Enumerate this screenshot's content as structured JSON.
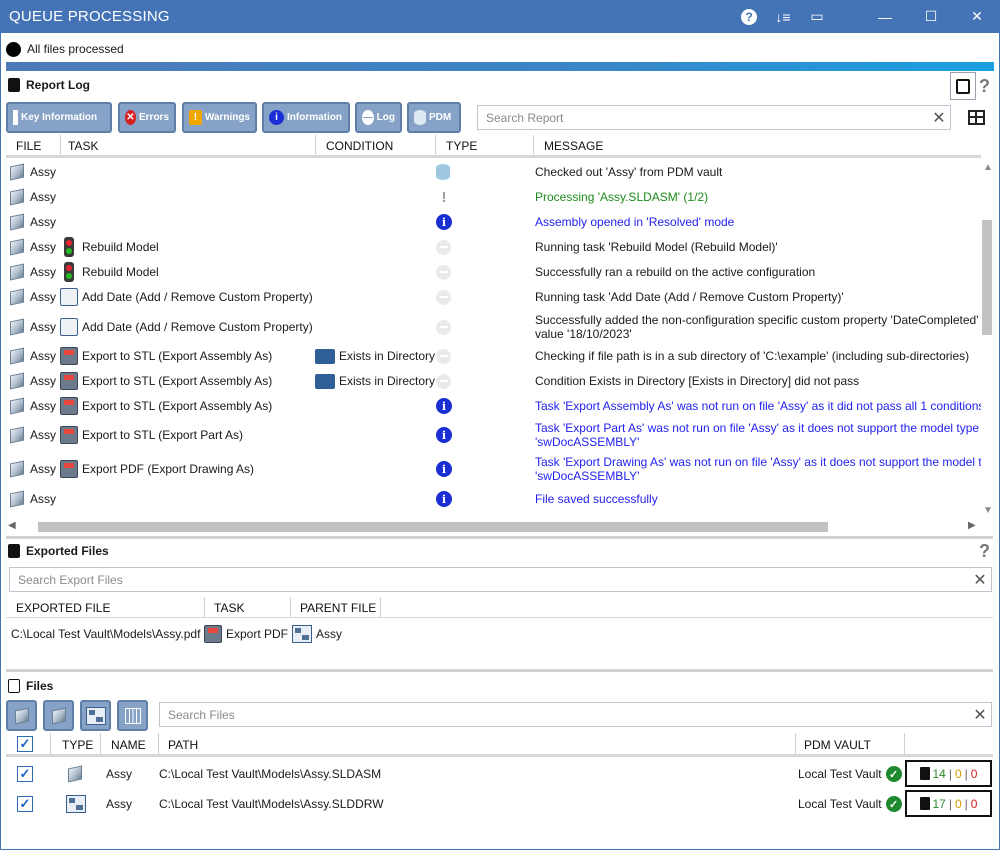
{
  "window": {
    "title": "QUEUE PROCESSING",
    "controls": {
      "help": "?",
      "sort": "↓≡",
      "maximize_panel": "▭",
      "minimize": "—",
      "restore": "☐",
      "close": "✕"
    }
  },
  "status": {
    "text": "All files processed",
    "progress_fraction": 1.0
  },
  "report_log": {
    "title": "Report Log",
    "filters": [
      {
        "label": "Key Information",
        "icon": "key-info-icon"
      },
      {
        "label": "Errors",
        "icon": "error-icon"
      },
      {
        "label": "Warnings",
        "icon": "warning-icon"
      },
      {
        "label": "Information",
        "icon": "info-icon"
      },
      {
        "label": "Log",
        "icon": "log-icon"
      },
      {
        "label": "PDM",
        "icon": "database-icon"
      }
    ],
    "search_placeholder": "Search Report",
    "columns": {
      "file": "FILE",
      "task": "TASK",
      "condition": "CONDITION",
      "type": "TYPE",
      "message": "MESSAGE"
    },
    "rows": [
      {
        "file": "Assy",
        "task": "",
        "task_icon": "",
        "condition": "",
        "type": "pdm",
        "message": "Checked out 'Assy' from PDM vault",
        "message2": "",
        "color": "normal"
      },
      {
        "file": "Assy",
        "task": "",
        "task_icon": "",
        "condition": "",
        "type": "warn",
        "message": "Processing 'Assy.SLDASM' (1/2)",
        "message2": "",
        "color": "green"
      },
      {
        "file": "Assy",
        "task": "",
        "task_icon": "",
        "condition": "",
        "type": "info",
        "message": "Assembly opened in 'Resolved' mode",
        "message2": "",
        "color": "blue"
      },
      {
        "file": "Assy",
        "task": "Rebuild Model",
        "task_icon": "traffic",
        "condition": "",
        "type": "log",
        "message": "Running task 'Rebuild Model (Rebuild Model)'",
        "message2": "",
        "color": "normal"
      },
      {
        "file": "Assy",
        "task": "Rebuild Model",
        "task_icon": "traffic",
        "condition": "",
        "type": "log",
        "message": "Successfully ran a rebuild on the active configuration",
        "message2": "",
        "color": "normal"
      },
      {
        "file": "Assy",
        "task": "Add Date (Add / Remove Custom Property)",
        "task_icon": "list",
        "condition": "",
        "type": "log",
        "message": "Running task 'Add Date (Add / Remove Custom Property)'",
        "message2": "",
        "color": "normal"
      },
      {
        "file": "Assy",
        "task": "Add Date (Add / Remove Custom Property)",
        "task_icon": "list",
        "condition": "",
        "type": "log",
        "message": "Successfully added the non-configuration specific custom property 'DateCompleted'",
        "message2": "value '18/10/2023'",
        "color": "normal"
      },
      {
        "file": "Assy",
        "task": "Export to STL (Export Assembly As)",
        "task_icon": "save",
        "condition": "Exists in Directory",
        "type": "log",
        "message": "Checking if file path is in a sub directory of 'C:\\example' (including sub-directories)",
        "message2": "",
        "color": "normal"
      },
      {
        "file": "Assy",
        "task": "Export to STL (Export Assembly As)",
        "task_icon": "save",
        "condition": "Exists in Directory",
        "type": "log",
        "message": "Condition Exists in Directory [Exists in Directory] did not pass",
        "message2": "",
        "color": "normal"
      },
      {
        "file": "Assy",
        "task": "Export to STL (Export Assembly As)",
        "task_icon": "save",
        "condition": "",
        "type": "info",
        "message": "Task 'Export Assembly As' was not run on file 'Assy' as it did not pass all 1 conditions",
        "message2": "",
        "color": "blue"
      },
      {
        "file": "Assy",
        "task": "Export to STL (Export Part As)",
        "task_icon": "save",
        "condition": "",
        "type": "info",
        "message": "Task 'Export Part As' was not run on file 'Assy' as it does not support the model type",
        "message2": "'swDocASSEMBLY'",
        "color": "blue"
      },
      {
        "file": "Assy",
        "task": "Export PDF (Export Drawing As)",
        "task_icon": "save",
        "condition": "",
        "type": "info",
        "message": "Task 'Export Drawing As' was not run on file 'Assy' as it does not support the model t",
        "message2": "'swDocASSEMBLY'",
        "color": "blue"
      },
      {
        "file": "Assy",
        "task": "",
        "task_icon": "",
        "condition": "",
        "type": "info",
        "message": "File saved successfully",
        "message2": "",
        "color": "blue"
      }
    ]
  },
  "exported_files": {
    "title": "Exported Files",
    "search_placeholder": "Search Export Files",
    "columns": {
      "exported_file": "EXPORTED FILE",
      "task": "TASK",
      "parent_file": "PARENT FILE"
    },
    "rows": [
      {
        "exported_file": "C:\\Local Test Vault\\Models\\Assy.pdf",
        "task": "Export PDF",
        "parent_file": "Assy"
      }
    ]
  },
  "files": {
    "title": "Files",
    "search_placeholder": "Search Files",
    "columns": {
      "type": "TYPE",
      "name": "NAME",
      "path": "PATH",
      "pdm_vault": "PDM VAULT"
    },
    "rows": [
      {
        "checked": true,
        "type_icon": "assembly-icon",
        "name": "Assy",
        "path": "C:\\Local Test Vault\\Models\\Assy.SLDASM",
        "vault": "Local Test Vault",
        "green": "14",
        "orange": "0",
        "red": "0"
      },
      {
        "checked": true,
        "type_icon": "drawing-icon",
        "name": "Assy",
        "path": "C:\\Local Test Vault\\Models\\Assy.SLDDRW",
        "vault": "Local Test Vault",
        "green": "17",
        "orange": "0",
        "red": "0"
      }
    ]
  }
}
